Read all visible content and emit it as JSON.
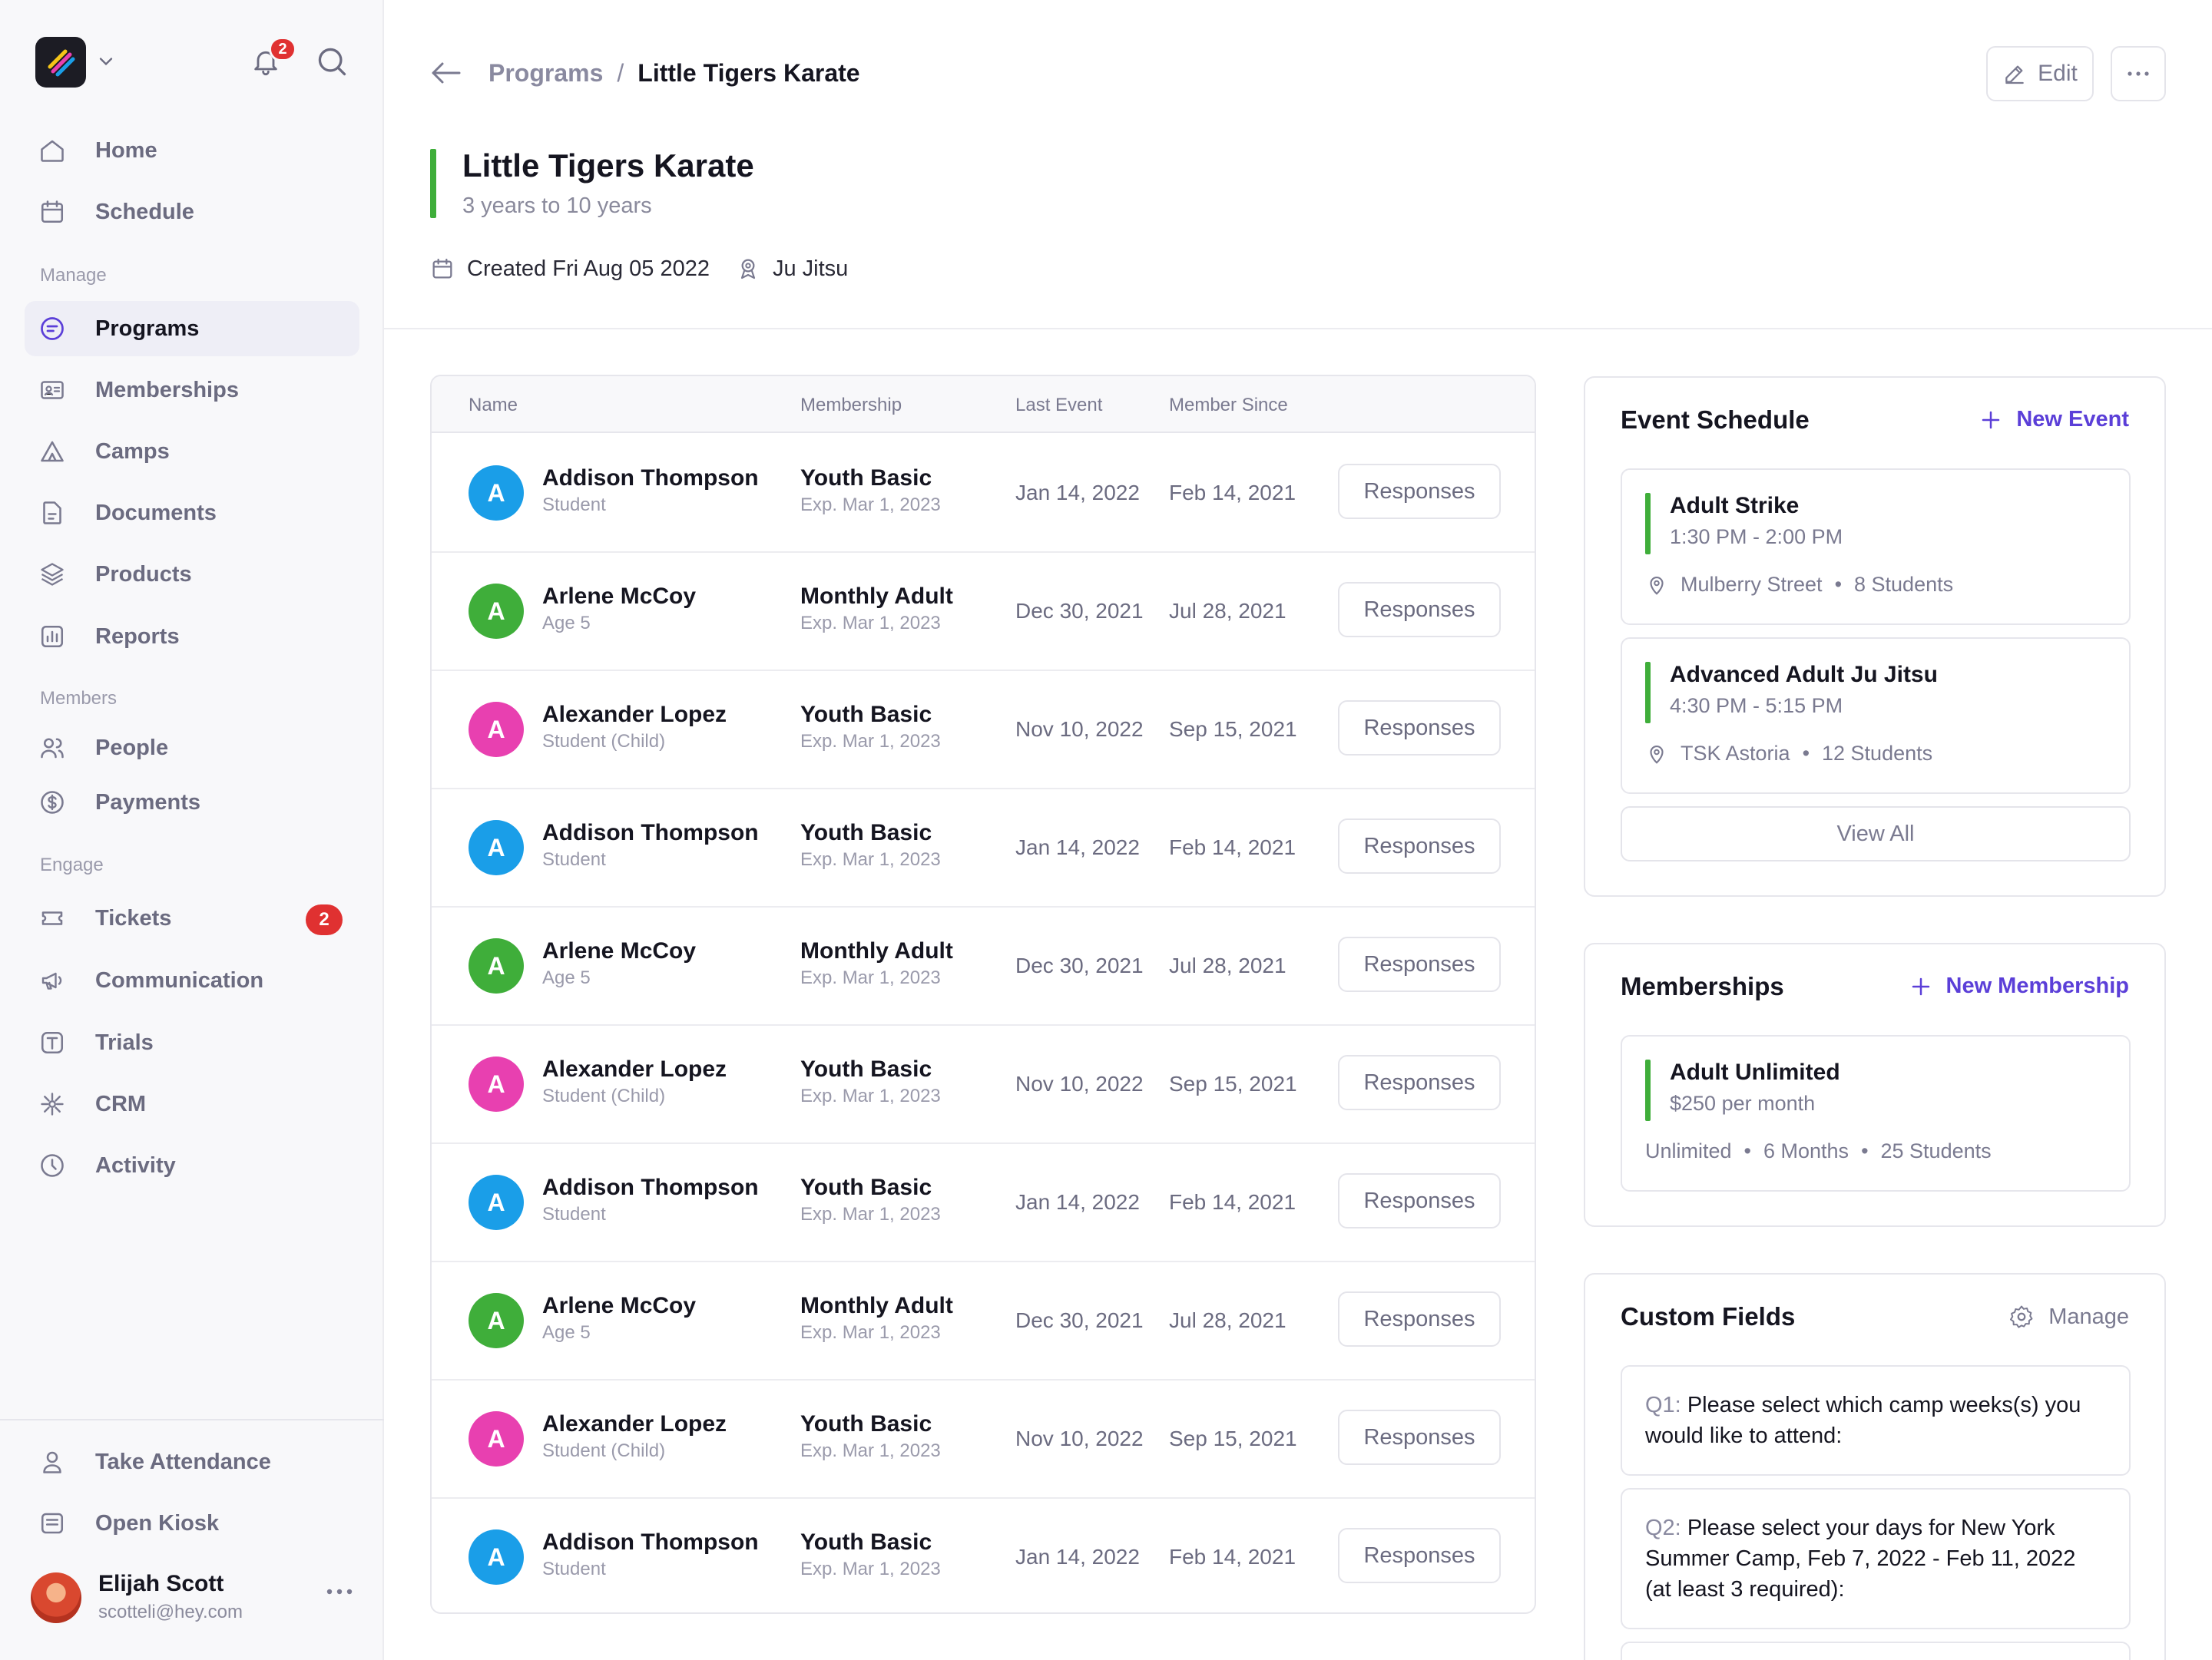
{
  "notifications": {
    "count": "2"
  },
  "sidebar": {
    "nav_top": [
      {
        "label": "Home",
        "icon": "home-icon"
      },
      {
        "label": "Schedule",
        "icon": "calendar-icon"
      }
    ],
    "manage_label": "Manage",
    "manage": [
      {
        "label": "Programs",
        "icon": "programs-icon",
        "active": true
      },
      {
        "label": "Memberships",
        "icon": "id-card-icon"
      },
      {
        "label": "Camps",
        "icon": "tent-icon"
      },
      {
        "label": "Documents",
        "icon": "document-icon"
      },
      {
        "label": "Products",
        "icon": "layers-icon"
      },
      {
        "label": "Reports",
        "icon": "chart-icon"
      }
    ],
    "members_label": "Members",
    "members": [
      {
        "label": "People",
        "icon": "people-icon"
      },
      {
        "label": "Payments",
        "icon": "dollar-icon"
      }
    ],
    "engage_label": "Engage",
    "engage": [
      {
        "label": "Tickets",
        "icon": "ticket-icon",
        "badge": "2"
      },
      {
        "label": "Communication",
        "icon": "megaphone-icon"
      },
      {
        "label": "Trials",
        "icon": "trial-icon"
      },
      {
        "label": "CRM",
        "icon": "crm-icon"
      },
      {
        "label": "Activity",
        "icon": "clock-icon"
      }
    ],
    "bottom": [
      {
        "label": "Take Attendance",
        "icon": "person-icon"
      },
      {
        "label": "Open Kiosk",
        "icon": "kiosk-icon"
      }
    ],
    "user": {
      "name": "Elijah Scott",
      "email": "scotteli@hey.com"
    }
  },
  "header": {
    "breadcrumb_parent": "Programs",
    "breadcrumb_sep": "/",
    "breadcrumb_current": "Little Tigers Karate",
    "edit_label": "Edit",
    "title": "Little Tigers Karate",
    "subtitle": "3 years to 10 years",
    "created": "Created Fri Aug 05 2022",
    "discipline": "Ju Jitsu"
  },
  "table": {
    "columns": [
      "Name",
      "Membership",
      "Last Event",
      "Member Since"
    ],
    "action_label": "Responses",
    "rows": [
      {
        "initial": "A",
        "color": "#1a9ee8",
        "name": "Addison Thompson",
        "sub": "Student",
        "membership": "Youth Basic",
        "expires": "Exp. Mar 1, 2023",
        "last_event": "Jan 14, 2022",
        "since": "Feb 14, 2021"
      },
      {
        "initial": "A",
        "color": "#3fae3a",
        "name": "Arlene McCoy",
        "sub": "Age 5",
        "membership": "Monthly Adult",
        "expires": "Exp. Mar 1, 2023",
        "last_event": "Dec 30, 2021",
        "since": "Jul 28, 2021"
      },
      {
        "initial": "A",
        "color": "#e840b0",
        "name": "Alexander Lopez",
        "sub": "Student (Child)",
        "membership": "Youth Basic",
        "expires": "Exp. Mar 1, 2023",
        "last_event": "Nov 10, 2022",
        "since": "Sep 15, 2021"
      },
      {
        "initial": "A",
        "color": "#1a9ee8",
        "name": "Addison Thompson",
        "sub": "Student",
        "membership": "Youth Basic",
        "expires": "Exp. Mar 1, 2023",
        "last_event": "Jan 14, 2022",
        "since": "Feb 14, 2021"
      },
      {
        "initial": "A",
        "color": "#3fae3a",
        "name": "Arlene McCoy",
        "sub": "Age 5",
        "membership": "Monthly Adult",
        "expires": "Exp. Mar 1, 2023",
        "last_event": "Dec 30, 2021",
        "since": "Jul 28, 2021"
      },
      {
        "initial": "A",
        "color": "#e840b0",
        "name": "Alexander Lopez",
        "sub": "Student (Child)",
        "membership": "Youth Basic",
        "expires": "Exp. Mar 1, 2023",
        "last_event": "Nov 10, 2022",
        "since": "Sep 15, 2021"
      },
      {
        "initial": "A",
        "color": "#1a9ee8",
        "name": "Addison Thompson",
        "sub": "Student",
        "membership": "Youth Basic",
        "expires": "Exp. Mar 1, 2023",
        "last_event": "Jan 14, 2022",
        "since": "Feb 14, 2021"
      },
      {
        "initial": "A",
        "color": "#3fae3a",
        "name": "Arlene McCoy",
        "sub": "Age 5",
        "membership": "Monthly Adult",
        "expires": "Exp. Mar 1, 2023",
        "last_event": "Dec 30, 2021",
        "since": "Jul 28, 2021"
      },
      {
        "initial": "A",
        "color": "#e840b0",
        "name": "Alexander Lopez",
        "sub": "Student (Child)",
        "membership": "Youth Basic",
        "expires": "Exp. Mar 1, 2023",
        "last_event": "Nov 10, 2022",
        "since": "Sep 15, 2021"
      },
      {
        "initial": "A",
        "color": "#1a9ee8",
        "name": "Addison Thompson",
        "sub": "Student",
        "membership": "Youth Basic",
        "expires": "Exp. Mar 1, 2023",
        "last_event": "Jan 14, 2022",
        "since": "Feb 14, 2021"
      }
    ]
  },
  "event_schedule": {
    "title": "Event Schedule",
    "action": "New Event",
    "events": [
      {
        "title": "Adult Strike",
        "time": "1:30 PM - 2:00 PM",
        "location": "Mulberry Street",
        "students": "8 Students"
      },
      {
        "title": "Advanced Adult Ju Jitsu",
        "time": "4:30 PM - 5:15 PM",
        "location": "TSK Astoria",
        "students": "12 Students"
      }
    ],
    "view_all": "View All"
  },
  "memberships_card": {
    "title": "Memberships",
    "action": "New Membership",
    "item": {
      "title": "Adult Unlimited",
      "price": "$250 per month",
      "limit": "Unlimited",
      "duration": "6 Months",
      "students": "25 Students"
    }
  },
  "custom_fields": {
    "title": "Custom Fields",
    "action": "Manage",
    "fields": [
      {
        "num": "Q1:",
        "text": "Please select which camp weeks(s) you would like to attend:"
      },
      {
        "num": "Q2:",
        "text": "Please select your days for New York Summer Camp, Feb 7, 2022 - Feb 11, 2022 (at least 3 required):"
      }
    ]
  },
  "colors": {
    "accent": "#5b3fd8",
    "green": "#3fae3a",
    "badge": "#e03131"
  }
}
